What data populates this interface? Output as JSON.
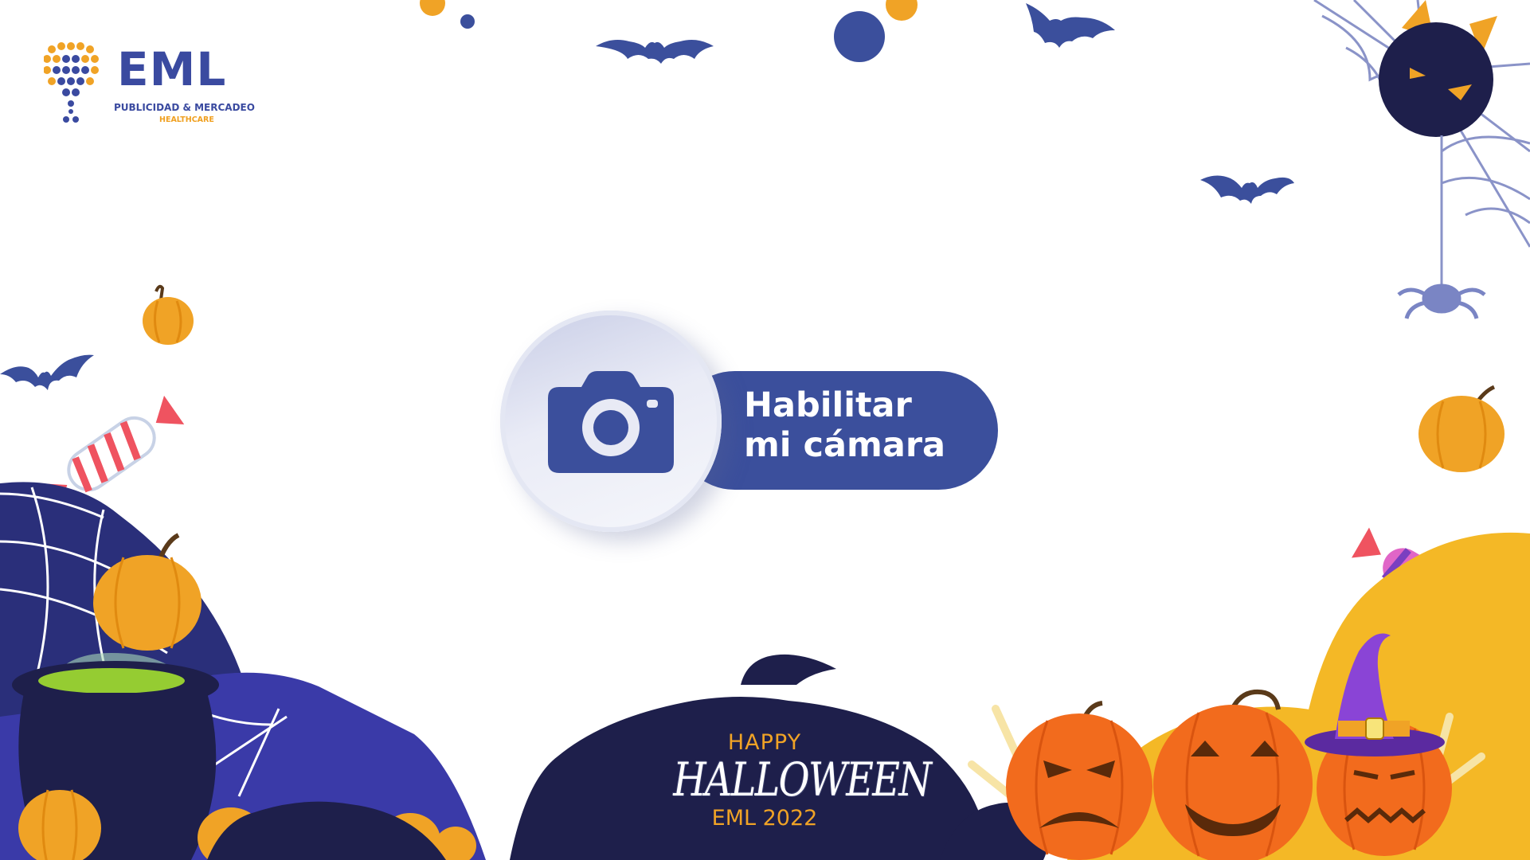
{
  "logo": {
    "title": "EML",
    "subtitle": "PUBLICIDAD & MERCADEO",
    "tagline": "HEALTHCARE"
  },
  "camera_button": {
    "line1": "Habilitar",
    "line2": "mi cámara",
    "icon": "camera-icon"
  },
  "halloween": {
    "happy": "HAPPY",
    "title": "HALLOWEEN",
    "year": "EML 2022"
  },
  "colors": {
    "brand_blue": "#3b4f9c",
    "dark_navy": "#1e1f4b",
    "orange": "#f0a326",
    "pumpkin": "#f26b1d",
    "purple": "#7a3fc0"
  }
}
